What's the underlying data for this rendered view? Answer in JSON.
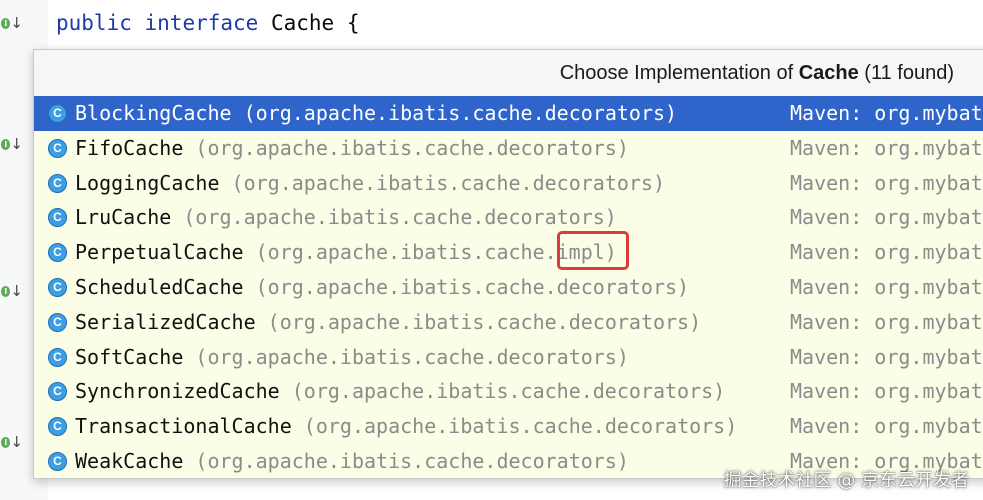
{
  "editor": {
    "code_keyword_1": "public",
    "code_keyword_2": "interface",
    "code_name": "Cache",
    "code_brace": "{",
    "gutter_badge": "I",
    "gutter_arrow": "↓"
  },
  "popup": {
    "title_prefix": "Choose Implementation of ",
    "title_class": "Cache",
    "title_suffix": " (11 found)",
    "class_icon_letter": "C",
    "items": [
      {
        "name": "BlockingCache",
        "package": " (org.apache.ibatis.cache.decorators)",
        "source": "Maven: org.mybat",
        "selected": true
      },
      {
        "name": "FifoCache",
        "package": " (org.apache.ibatis.cache.decorators)",
        "source": "Maven: org.mybat"
      },
      {
        "name": "LoggingCache",
        "package": " (org.apache.ibatis.cache.decorators)",
        "source": "Maven: org.mybat"
      },
      {
        "name": "LruCache",
        "package": " (org.apache.ibatis.cache.decorators)",
        "source": "Maven: org.mybat"
      },
      {
        "name": "PerpetualCache",
        "package": " (org.apache.ibatis.cache.impl)",
        "source": "Maven: org.mybat"
      },
      {
        "name": "ScheduledCache",
        "package": " (org.apache.ibatis.cache.decorators)",
        "source": "Maven: org.mybat"
      },
      {
        "name": "SerializedCache",
        "package": " (org.apache.ibatis.cache.decorators)",
        "source": "Maven: org.mybat"
      },
      {
        "name": "SoftCache",
        "package": " (org.apache.ibatis.cache.decorators)",
        "source": "Maven: org.mybat"
      },
      {
        "name": "SynchronizedCache",
        "package": " (org.apache.ibatis.cache.decorators)",
        "source": "Maven: org.mybat"
      },
      {
        "name": "TransactionalCache",
        "package": " (org.apache.ibatis.cache.decorators)",
        "source": "Maven: org.mybat"
      },
      {
        "name": "WeakCache",
        "package": " (org.apache.ibatis.cache.decorators)",
        "source": "Maven: org.mybat"
      }
    ]
  },
  "watermark": "掘金技术社区 @ 京东云开发者",
  "colors": {
    "selection": "#2f65ca",
    "popup_background": "#fcfde6",
    "highlight_box": "#dc3b3b",
    "keyword": "#1c3aa8",
    "class_icon": "#3d9ee6"
  },
  "icons": {
    "class_icon": "class-c-icon",
    "gutter_icon": "implemented-down-arrow-icon",
    "highlight": "red-annotation-box"
  }
}
